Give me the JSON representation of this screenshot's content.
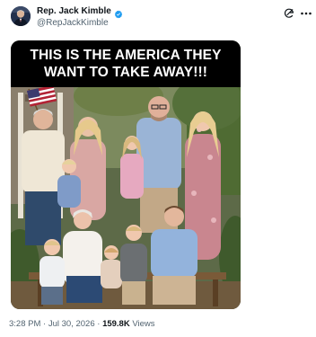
{
  "author": {
    "display_name": "Rep. Jack Kimble",
    "handle": "@RepJackKimble",
    "verified_badge_color": "#1d9bf0",
    "avatar_icon": "avatar-photo"
  },
  "header_actions": {
    "grok_icon": "grok-icon",
    "more_icon": "more-options-icon"
  },
  "media": {
    "caption_line_1": "THIS IS THE AMERICA THEY",
    "caption_line_2": "WANT TO TAKE AWAY!!!"
  },
  "meta": {
    "time": "3:28 PM",
    "separator": "·",
    "date": "Jul 30, 2026",
    "views_count": "159.8K",
    "views_label": "Views"
  },
  "colors": {
    "text_primary": "#0f1419",
    "text_secondary": "#536471",
    "verified": "#1d9bf0"
  }
}
